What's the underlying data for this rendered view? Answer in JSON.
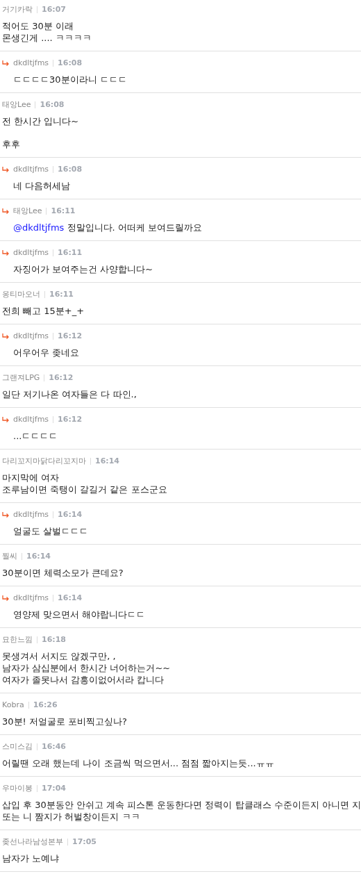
{
  "comments": [
    {
      "kind": "comment",
      "author": "거기카락",
      "time": "16:07",
      "paragraphs": [
        "적어도 30분 이래\n몬생긴게 .... ㅋㅋㅋㅋ"
      ]
    },
    {
      "kind": "reply",
      "author": "dkdltjfms",
      "time": "16:08",
      "paragraphs": [
        "ㄷㄷㄷㄷ30분이라니 ㄷㄷㄷ"
      ]
    },
    {
      "kind": "comment",
      "author": "태앙Lee",
      "time": "16:08",
      "paragraphs": [
        "전 한시간 입니다~",
        "후후"
      ]
    },
    {
      "kind": "reply",
      "author": "dkdltjfms",
      "time": "16:08",
      "paragraphs": [
        "네 다음허세남"
      ]
    },
    {
      "kind": "reply",
      "author": "태앙Lee",
      "time": "16:11",
      "mention": "@dkdltjfms",
      "paragraphs": [
        "정말입니다. 어떠케 보여드릴까요"
      ]
    },
    {
      "kind": "reply",
      "author": "dkdltjfms",
      "time": "16:11",
      "paragraphs": [
        "자징어가 보여주는건 사양합니다~"
      ]
    },
    {
      "kind": "comment",
      "author": "옹티마오너",
      "time": "16:11",
      "paragraphs": [
        "전희 빼고 15분+_+"
      ]
    },
    {
      "kind": "reply",
      "author": "dkdltjfms",
      "time": "16:12",
      "paragraphs": [
        "어우어우 좆네요"
      ]
    },
    {
      "kind": "comment",
      "author": "그랜져LPG",
      "time": "16:12",
      "paragraphs": [
        "일단 저기나온 여자들은 다 따인.,"
      ]
    },
    {
      "kind": "reply",
      "author": "dkdltjfms",
      "time": "16:12",
      "paragraphs": [
        "...ㄷㄷㄷㄷ"
      ]
    },
    {
      "kind": "comment",
      "author": "다리꼬지마닭다리꼬지마",
      "time": "16:14",
      "paragraphs": [
        "마지막에 여자\n조루남이면 죽탱이 갈길거 같은 포스군요"
      ]
    },
    {
      "kind": "reply",
      "author": "dkdltjfms",
      "time": "16:14",
      "paragraphs": [
        "얼굴도 살벌ㄷㄷㄷ"
      ]
    },
    {
      "kind": "comment",
      "author": "찔씨",
      "time": "16:14",
      "paragraphs": [
        "30분이면 체력소모가 큰데요?"
      ]
    },
    {
      "kind": "reply",
      "author": "dkdltjfms",
      "time": "16:14",
      "paragraphs": [
        "영양제 맞으면서 해야랍니다ㄷㄷ"
      ]
    },
    {
      "kind": "comment",
      "author": "묘한느낌",
      "time": "16:18",
      "paragraphs": [
        "못생겨서 서지도 않겠구만, ,\n남자가 삼십분에서 한시간 너어하는거~~\n여자가 졸못나서 감흥이없어서라 캅니다"
      ]
    },
    {
      "kind": "comment",
      "author": "Kobra",
      "time": "16:26",
      "paragraphs": [
        "30분! 저얼굴로 포비찍고싶나?"
      ]
    },
    {
      "kind": "comment",
      "author": "스미스김",
      "time": "16:46",
      "paragraphs": [
        "어릴땐 오래 했는데 나이 조금씩 먹으면서... 점점 짧아지는듯...ㅠㅠ"
      ]
    },
    {
      "kind": "comment",
      "author": "우마이봉",
      "time": "17:04",
      "paragraphs": [
        "삽입 후 30분동안 안쉬고 계속 피스톤 운동한다면 정력이 탑클래스 수준이든지 아니면 지\n또는 니 짬지가 허벌창이든지 ㅋㅋ"
      ]
    },
    {
      "kind": "comment",
      "author": "좆선나라남성본부",
      "time": "17:05",
      "paragraphs": [
        "남자가 노예냐"
      ]
    }
  ]
}
